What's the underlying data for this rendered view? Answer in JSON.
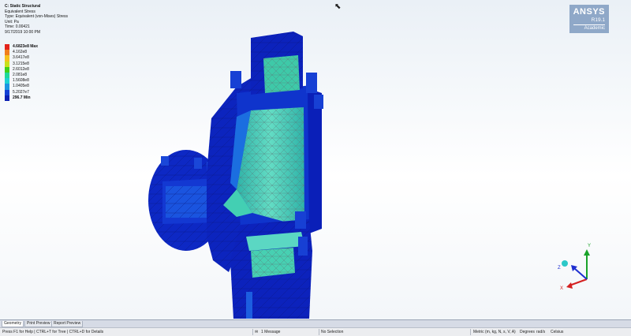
{
  "info": {
    "system": "C: Static Structural",
    "result": "Equivalent Stress",
    "type": "Type: Equivalent (von-Mises) Stress",
    "unit": "Unit: Pa",
    "time": "Time: 0.00421",
    "date": "9/17/2019 10:00 PM"
  },
  "legend": [
    {
      "label": "4.6823e8 Max",
      "color": "#e3231b",
      "bold": true
    },
    {
      "label": "4.162e8",
      "color": "#f07e1c"
    },
    {
      "label": "3.6417e8",
      "color": "#f5c21c"
    },
    {
      "label": "3.1215e8",
      "color": "#c9e01b"
    },
    {
      "label": "2.6012e8",
      "color": "#3fd11a"
    },
    {
      "label": "2.081e8",
      "color": "#1ed89a"
    },
    {
      "label": "1.5608e8",
      "color": "#1cd3d2"
    },
    {
      "label": "1.0405e8",
      "color": "#1b95e2"
    },
    {
      "label": "5.2027e7",
      "color": "#1340d4"
    },
    {
      "label": "296.7 Min",
      "color": "#0b1fb2",
      "bold": true
    }
  ],
  "brand": {
    "name": "ANSYS",
    "release": "R19.1",
    "edition": "Academic",
    "color": "#8fa8c8"
  },
  "colors": {
    "mesh_dark": "#0a1fb8",
    "mesh_mid": "#1b5ce0",
    "mesh_light": "#3bc9a6"
  },
  "triad": {
    "x": "X",
    "y": "Y",
    "z": "Z"
  },
  "tabs": [
    {
      "label": "Geometry",
      "active": true
    },
    {
      "label": "Print Preview",
      "active": false
    },
    {
      "label": "Report Preview",
      "active": false
    }
  ],
  "status": {
    "hint": "Press F1 for Help  |  CTRL+T for Tree  |  CTRL+D for Details",
    "messages": "1 Message",
    "selection": "No Selection",
    "units": "Metric (m, kg, N, s, V, A)",
    "angle": "Degrees",
    "rate": "rad/s",
    "temp": "Celsius"
  }
}
